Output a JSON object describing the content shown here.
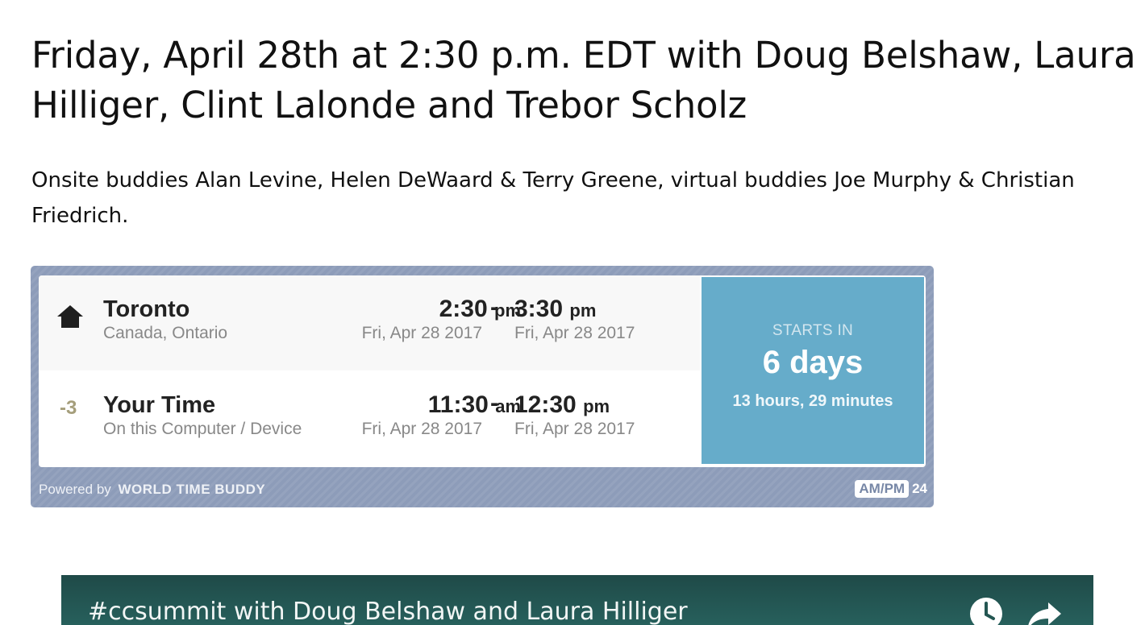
{
  "page": {
    "title": "Friday, April 28th at 2:30 p.m. EDT with Doug Belshaw, Laura Hilliger, Clint Lalonde and Trebor Scholz",
    "intro": "Onsite buddies Alan Levine, Helen DeWaard & Terry Greene, virtual buddies Joe Murphy & Christian Friedrich."
  },
  "widget": {
    "rows": [
      {
        "marker": "home-icon",
        "offset": "",
        "city": "Toronto",
        "region": "Canada, Ontario",
        "start_time": "2:30",
        "start_ampm": "pm",
        "separator": "-",
        "end_time": "3:30",
        "end_ampm": "pm",
        "start_date": "Fri, Apr 28 2017",
        "end_date": "Fri, Apr 28 2017"
      },
      {
        "marker": "",
        "offset": "-3",
        "city": "Your Time",
        "region": "On this Computer / Device",
        "start_time": "11:30",
        "start_ampm": "am",
        "separator": "-",
        "end_time": "12:30",
        "end_ampm": "pm",
        "start_date": "Fri, Apr 28 2017",
        "end_date": "Fri, Apr 28 2017"
      }
    ],
    "countdown": {
      "label": "STARTS IN",
      "days": "6 days",
      "detail": "13 hours, 29 minutes"
    },
    "footer": {
      "powered_by": "Powered by",
      "brand": "WORLD TIME BUDDY",
      "ampm_toggle": "AM/PM",
      "h24_toggle": "24"
    },
    "colors": {
      "frame": "#8d9cb9",
      "countdown_panel": "#66acca",
      "offset_text": "#a59e7b"
    }
  },
  "video": {
    "title": "#ccsummit with Doug Belshaw and Laura Hilliger",
    "icons": [
      "clock-icon",
      "share-icon"
    ],
    "colors": {
      "bar": "#27605c"
    }
  }
}
